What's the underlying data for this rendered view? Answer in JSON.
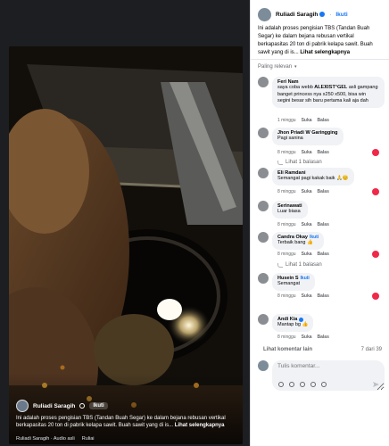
{
  "video": {
    "author": "Ruliadi Saragih",
    "follow_label": "Ikuti",
    "caption": "Ini adalah proses pengisian TBS (Tandan Buah Segar) ke dalam bejana rebusan vertikal berkapasitas 20 ton di pabrik kelapa sawit. Buah sawit yang di is...",
    "see_more": "Lihat selengkapnya",
    "audio": "Ruliadi Saragih · Audio asli",
    "reels": "Ruliai"
  },
  "post": {
    "author": "Ruliadi Saragih",
    "dot": "·",
    "follow_label": "Ikuti",
    "text": "Ini adalah proses pengisian TBS (Tandan Buah Segar) ke dalam bejana rebusan vertikal berkapasitas 20 ton di pabrik kelapa sawit. Buah sawit yang di is...",
    "see_more": "Lihat selengkapnya"
  },
  "sort_label": "Paling relevan",
  "comments": [
    {
      "name": "Feri Nam",
      "text": "saya coba webb 𝐀𝐋𝐄𝐗𝐈𝐒𝐓*𝐆𝐄𝐋 asli gampang banget princess nya x250 x500, bisa win segini besar sih baru pertama kali aja dah",
      "time": "1 minggu",
      "like": "Suka",
      "reply": "Balas"
    },
    {
      "name": "Jhon Priadi W Garingging",
      "text": "Pagi sanina",
      "time": "8 minggu",
      "like": "Suka",
      "reply": "Balas",
      "replies": "Lihat 1 balasan"
    },
    {
      "name": "Eli Ramdani",
      "text": "Semangat pagi kakak baik 🙏😊",
      "time": "8 minggu",
      "like": "Suka",
      "reply": "Balas"
    },
    {
      "name": "Serinawati",
      "text": "Luar biasa",
      "time": "8 minggu",
      "like": "Suka",
      "reply": "Balas"
    },
    {
      "name": "Candra Okay",
      "badge": "Ikuti",
      "text": "Terbaik bang 👍",
      "time": "8 minggu",
      "like": "Suka",
      "reply": "Balas",
      "replies": "Lihat 1 balasan"
    },
    {
      "name": "Husein S",
      "badge": "Ikuti",
      "text": "Semangat",
      "time": "8 minggu",
      "like": "Suka",
      "reply": "Balas"
    },
    {
      "name": "Andi Kia",
      "text": "Mantap bg 👍",
      "time": "8 minggu",
      "like": "Suka",
      "reply": "Balas"
    }
  ],
  "more_comments": "Lihat komentar lain",
  "counter": "7 dari 39",
  "composer": {
    "placeholder": "Tulis komentar..."
  },
  "colors": {
    "accent": "#1877f2",
    "bubble": "#f0f2f5",
    "secondary_text": "#65676b",
    "reaction": "#f02849"
  }
}
